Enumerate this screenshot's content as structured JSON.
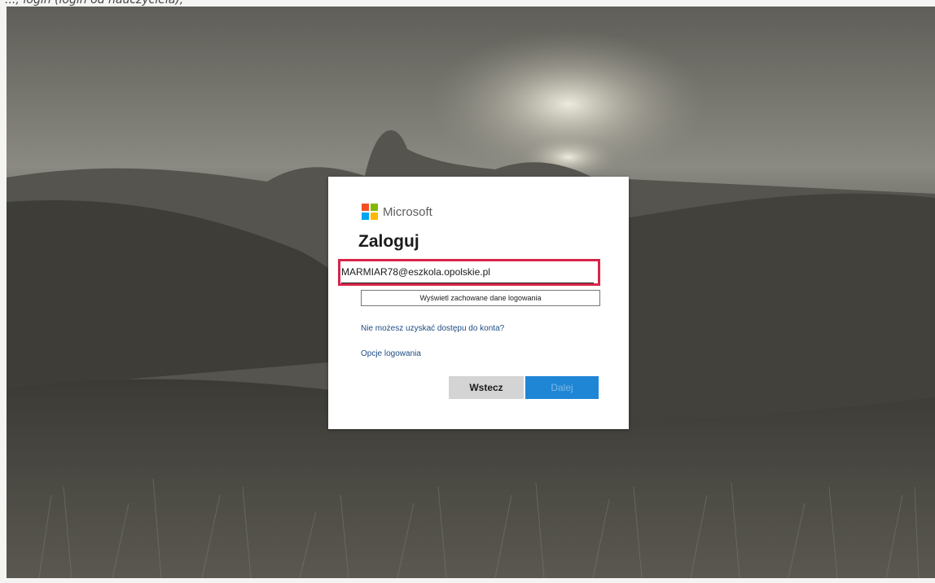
{
  "caption": "...; login (login od nauczyciela);",
  "brand": {
    "name": "Microsoft",
    "logo_colors": [
      "#f25022",
      "#7fba00",
      "#00a4ef",
      "#ffb900"
    ]
  },
  "signin": {
    "title": "Zaloguj",
    "email_value": "MARMIAR78@eszkola.opolskie.pl",
    "saved_logins_label": "Wyświetl zachowane dane logowania",
    "cant_access_link": "Nie możesz uzyskać dostępu do konta?",
    "signin_options_link": "Opcje logowania",
    "back_button": "Wstecz",
    "next_button": "Dalej"
  },
  "colors": {
    "highlight": "#d7264a",
    "primary_button": "#1f86d6",
    "link": "#1c4c84"
  }
}
